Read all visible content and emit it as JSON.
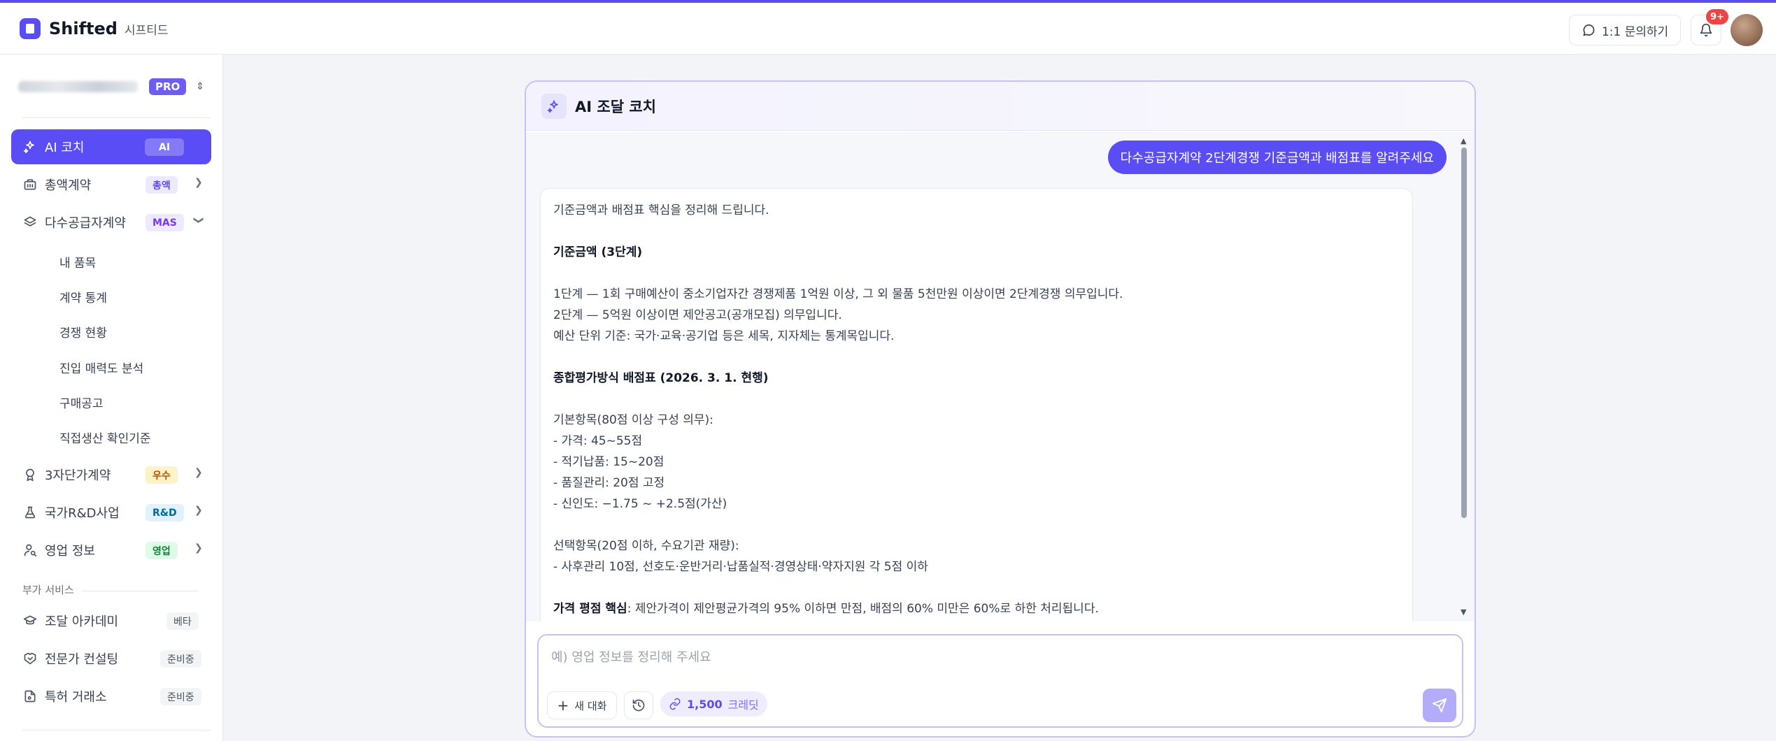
{
  "brand": {
    "name": "Shifted",
    "subtitle": "시프티드",
    "accent": "#5b4df5"
  },
  "header": {
    "inquiry_label": "1:1 문의하기",
    "notification_count": "9+"
  },
  "workspace": {
    "plan_badge": "PRO"
  },
  "sidebar": {
    "items": [
      {
        "label": "AI 코치",
        "tag": "AI",
        "icon": "sparkles-icon",
        "active": true
      },
      {
        "label": "총액계약",
        "tag": "총액",
        "icon": "building-icon"
      },
      {
        "label": "다수공급자계약",
        "tag": "MAS",
        "icon": "layers-icon",
        "expanded": true
      },
      {
        "label": "3자단가계약",
        "tag": "우수",
        "icon": "award-icon"
      },
      {
        "label": "국가R&D사업",
        "tag": "R&D",
        "icon": "flask-icon"
      },
      {
        "label": "영업 정보",
        "tag": "영업",
        "icon": "user-search-icon"
      }
    ],
    "sub_items": [
      "내 품목",
      "계약 통계",
      "경쟁 현황",
      "진입 매력도 분석",
      "구매공고",
      "직접생산 확인기준"
    ],
    "extra_section_title": "부가 서비스",
    "extra_items": [
      {
        "label": "조달 아카데미",
        "tag": "베타",
        "icon": "graduation-cap-icon"
      },
      {
        "label": "전문가 컨설팅",
        "tag": "준비중",
        "icon": "handshake-icon"
      },
      {
        "label": "특허 거래소",
        "tag": "준비중",
        "icon": "patent-document-icon"
      }
    ]
  },
  "chat": {
    "title": "AI 조달 코치",
    "user_message": "다수공급자계약 2단계경쟁 기준금액과 배점표를 알려주세요",
    "ai_message": {
      "intro": "기준금액과 배점표 핵심을 정리해 드립니다.",
      "heading1": "기준금액 (3단계)",
      "line1": "1단계 — 1회 구매예산이 중소기업자간 경쟁제품 1억원 이상, 그 외 물품 5천만원 이상이면 2단계경쟁 의무입니다.",
      "line2": "2단계 — 5억원 이상이면 제안공고(공개모집) 의무입니다.",
      "line3": "예산 단위 기준: 국가·교육·공기업 등은 세목, 지자체는 통계목입니다.",
      "heading2": "종합평가방식 배점표 (2026. 3. 1. 현행)",
      "basic_title": "기본항목(80점 이상 구성 의무):",
      "basic_items": [
        "- 가격: 45~55점",
        "- 적기납품: 15~20점",
        "- 품질관리: 20점 고정",
        "- 신인도: −1.75 ~ +2.5점(가산)"
      ],
      "optional_title": "선택항목(20점 이하, 수요기관 재량):",
      "optional_item": "- 사후관리 10점, 선호도·운반거리·납품실적·경영상태·약자지원 각 5점 이하",
      "price_bold": "가격 평점 핵심",
      "price_text": ": 제안가격이 제안평균가격의 95% 이하면 만점, 배점의 60% 미만은 60%로 하한 처리됩니다."
    },
    "composer": {
      "placeholder": "예) 영업 정보를 정리해 주세요",
      "new_chat_label": "새 대화",
      "credits_value": "1,500",
      "credits_unit": "크레딧"
    }
  }
}
